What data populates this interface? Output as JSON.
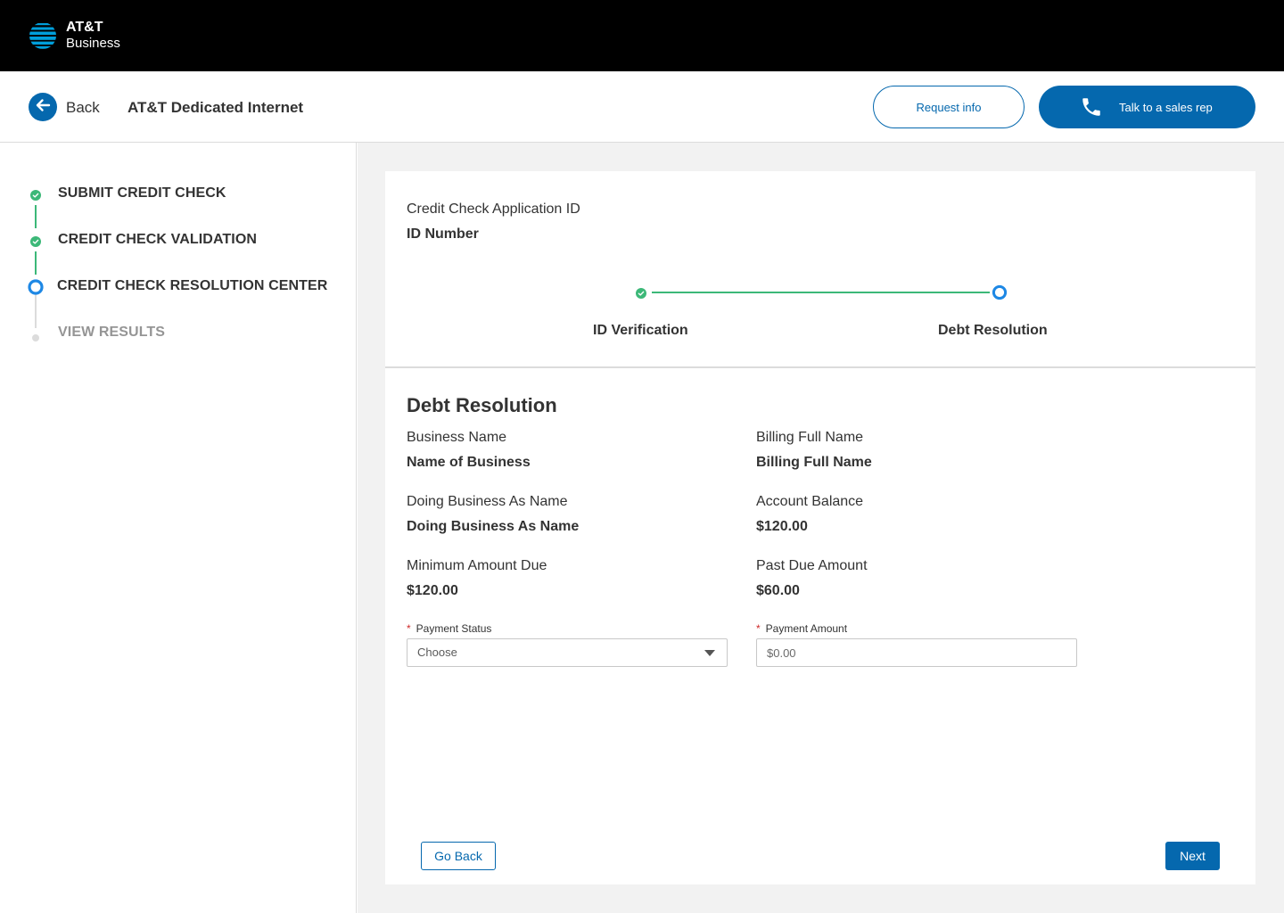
{
  "brand": {
    "line1": "AT&T",
    "line2": "Business",
    "logo_icon": "att-globe-icon"
  },
  "header": {
    "back_label": "Back",
    "back_icon": "arrow-left-icon",
    "product_title": "AT&T Dedicated Internet",
    "request_info_label": "Request info",
    "sales_label": "Talk to a sales rep",
    "sales_icon": "phone-icon"
  },
  "sidebar": {
    "steps": [
      {
        "label": "SUBMIT CREDIT CHECK",
        "status": "complete"
      },
      {
        "label": "CREDIT CHECK VALIDATION",
        "status": "complete"
      },
      {
        "label": "CREDIT CHECK RESOLUTION CENTER",
        "status": "current"
      },
      {
        "label": "VIEW RESULTS",
        "status": "inactive"
      }
    ]
  },
  "application": {
    "id_label": "Credit Check Application ID",
    "id_value": "ID Number"
  },
  "progress": {
    "steps": [
      {
        "label": "ID Verification",
        "status": "complete"
      },
      {
        "label": "Debt Resolution",
        "status": "current"
      }
    ]
  },
  "debt": {
    "title": "Debt Resolution",
    "business_name_label": "Business Name",
    "business_name_value": "Name of Business",
    "billing_name_label": "Billing Full Name",
    "billing_name_value": "Billing Full Name",
    "dba_label": "Doing Business As Name",
    "dba_value": "Doing Business As Name",
    "account_balance_label": "Account Balance",
    "account_balance_value": "$120.00",
    "min_due_label": "Minimum Amount Due",
    "min_due_value": "$120.00",
    "past_due_label": "Past Due Amount",
    "past_due_value": "$60.00",
    "payment_status_label": "Payment Status",
    "payment_status_value": "Choose",
    "payment_amount_label": "Payment Amount",
    "payment_amount_placeholder": "$0.00",
    "required_mark": "*"
  },
  "actions": {
    "go_back_label": "Go Back",
    "next_label": "Next"
  },
  "colors": {
    "primary": "#0568ae",
    "success": "#3cb878",
    "brand_blue": "#009fdb"
  }
}
